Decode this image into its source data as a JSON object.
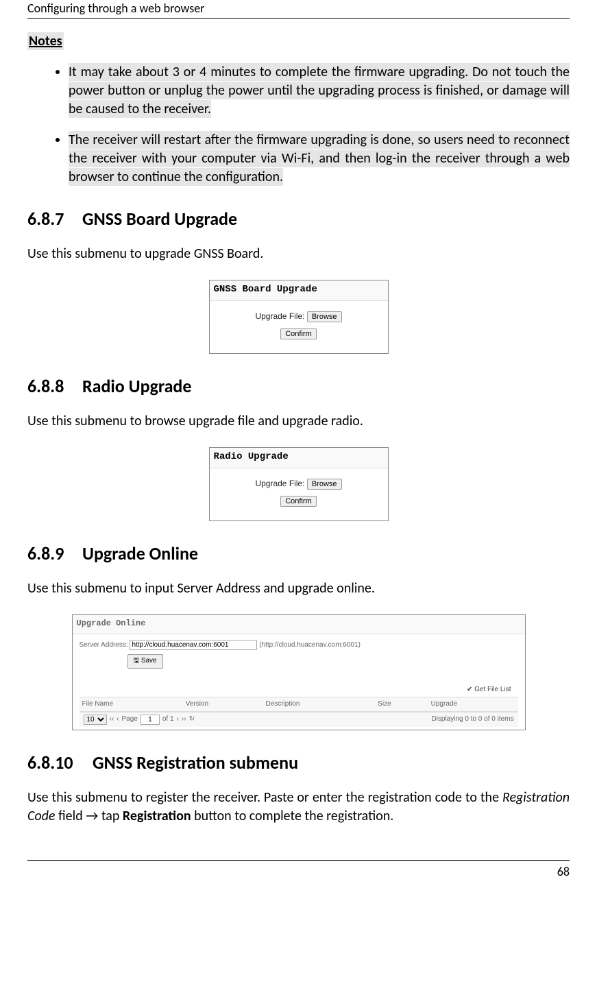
{
  "header": "Configuring through a web browser",
  "notes_heading": "Notes",
  "notes": [
    "It may take about 3 or 4 minutes to complete the firmware upgrading. Do not touch the power button or unplug the power until the upgrading process is finished, or damage will be caused to the receiver.  ",
    "The receiver will restart after the firmware upgrading is done, so users need to reconnect the receiver with your computer via Wi-Fi, and then log-in the receiver through a web browser to continue the configuration.  "
  ],
  "s687": {
    "num": "6.8.7",
    "title": "GNSS Board Upgrade",
    "desc": "Use this submenu to upgrade GNSS Board.",
    "fig_title": "GNSS Board Upgrade",
    "label": "Upgrade File:",
    "browse": "Browse",
    "confirm": "Confirm"
  },
  "s688": {
    "num": "6.8.8",
    "title": "Radio Upgrade",
    "desc": "Use this submenu to browse upgrade file and upgrade radio.",
    "fig_title": "Radio Upgrade",
    "label": "Upgrade File:",
    "browse": "Browse",
    "confirm": "Confirm"
  },
  "s689": {
    "num": "6.8.9",
    "title": "Upgrade Online",
    "desc": "Use this submenu to input Server Address and upgrade online.",
    "fig_title": "Upgrade Online",
    "server_label": "Server Address:",
    "server_value": "http://cloud.huacenav.com:6001",
    "server_hint": "(http://cloud.huacenav.com:6001)",
    "save": "Save",
    "get_file_list": "Get File List",
    "cols": {
      "c1": "File Name",
      "c2": "Version",
      "c3": "Description",
      "c4": "Size",
      "c5": "Upgrade"
    },
    "pager": {
      "page_label": "Page",
      "page_val": "1",
      "of": "of 1",
      "per": "10",
      "status": "Displaying 0 to 0 of 0 items"
    }
  },
  "s6810": {
    "num": "6.8.10",
    "title": "GNSS Registration submenu",
    "desc_a": "Use this submenu to register the receiver. Paste or enter the registration code to the ",
    "desc_b": "Registration Code",
    "desc_c": " field → tap ",
    "desc_d": "Registration",
    "desc_e": " button to complete the registration."
  },
  "page_num": "68"
}
